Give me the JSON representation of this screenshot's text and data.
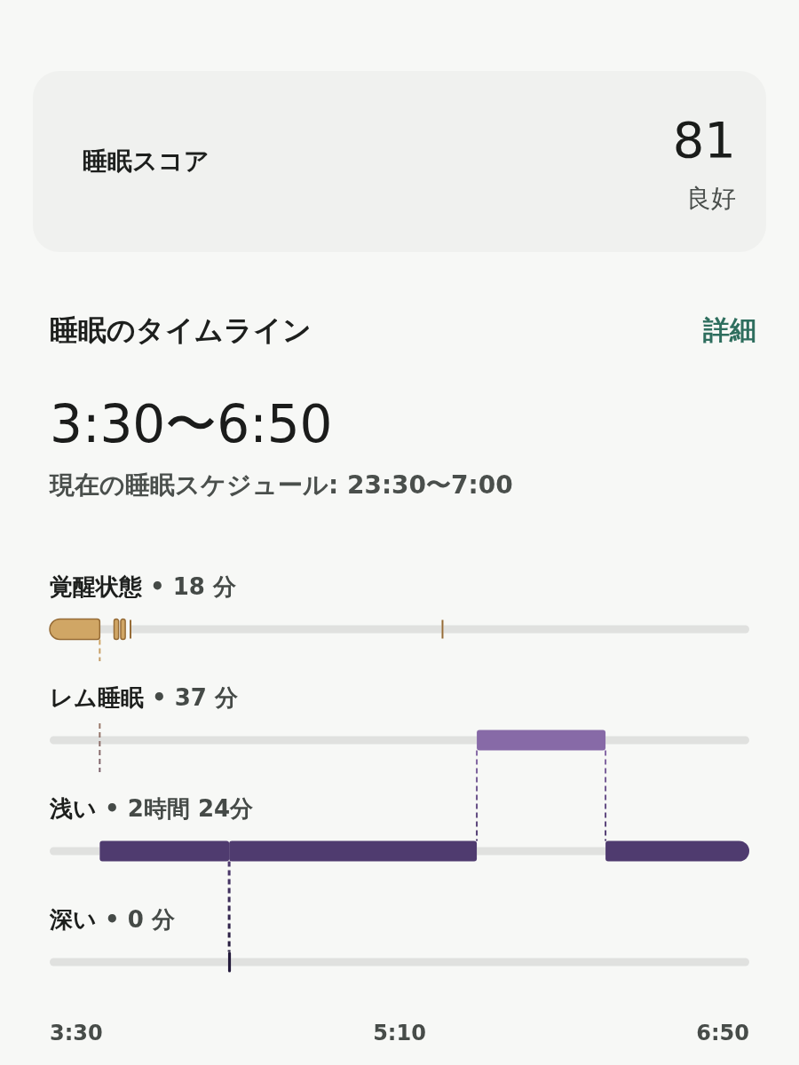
{
  "score_card": {
    "title": "睡眠スコア",
    "score": "81",
    "rating": "良好"
  },
  "timeline": {
    "title": "睡眠のタイムライン",
    "details_link": "詳細",
    "range": "3:30〜6:50",
    "schedule": "現在の睡眠スケジュール: 23:30〜7:00",
    "stages": [
      {
        "kind": "awake",
        "name": "覚醒状態",
        "summary": "• 18 分",
        "color": "#d0a665"
      },
      {
        "kind": "rem",
        "name": "レム睡眠",
        "summary": "• 37 分",
        "color": "#876aa7"
      },
      {
        "kind": "light",
        "name": "浅い",
        "summary": "• 2時間 24分",
        "color": "#4f3b6f"
      },
      {
        "kind": "deep",
        "name": "深い",
        "summary": "• 0 分",
        "color": "#241b3b"
      }
    ],
    "axis_labels": [
      "3:30",
      "5:10",
      "6:50"
    ]
  }
}
